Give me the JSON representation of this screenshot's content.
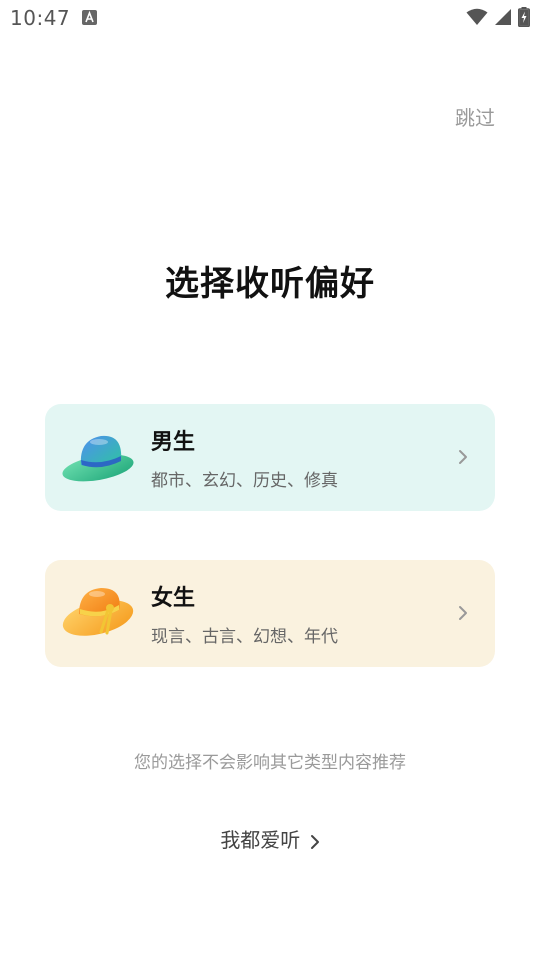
{
  "status_bar": {
    "time": "10:47",
    "app_icon": "a-icon",
    "wifi_icon": "wifi-icon",
    "signal_icon": "cell-signal-icon",
    "battery_icon": "battery-charging-icon"
  },
  "header": {
    "skip_label": "跳过"
  },
  "main": {
    "title": "选择收听偏好",
    "cards": [
      {
        "title": "男生",
        "subtitle": "都市、玄幻、历史、修真",
        "icon": "green-hat-icon",
        "color": "#e3f6f3"
      },
      {
        "title": "女生",
        "subtitle": "现言、古言、幻想、年代",
        "icon": "orange-sun-hat-icon",
        "color": "#faf2df"
      }
    ],
    "notice": "您的选择不会影响其它类型内容推荐",
    "love_all_label": "我都爱听"
  }
}
